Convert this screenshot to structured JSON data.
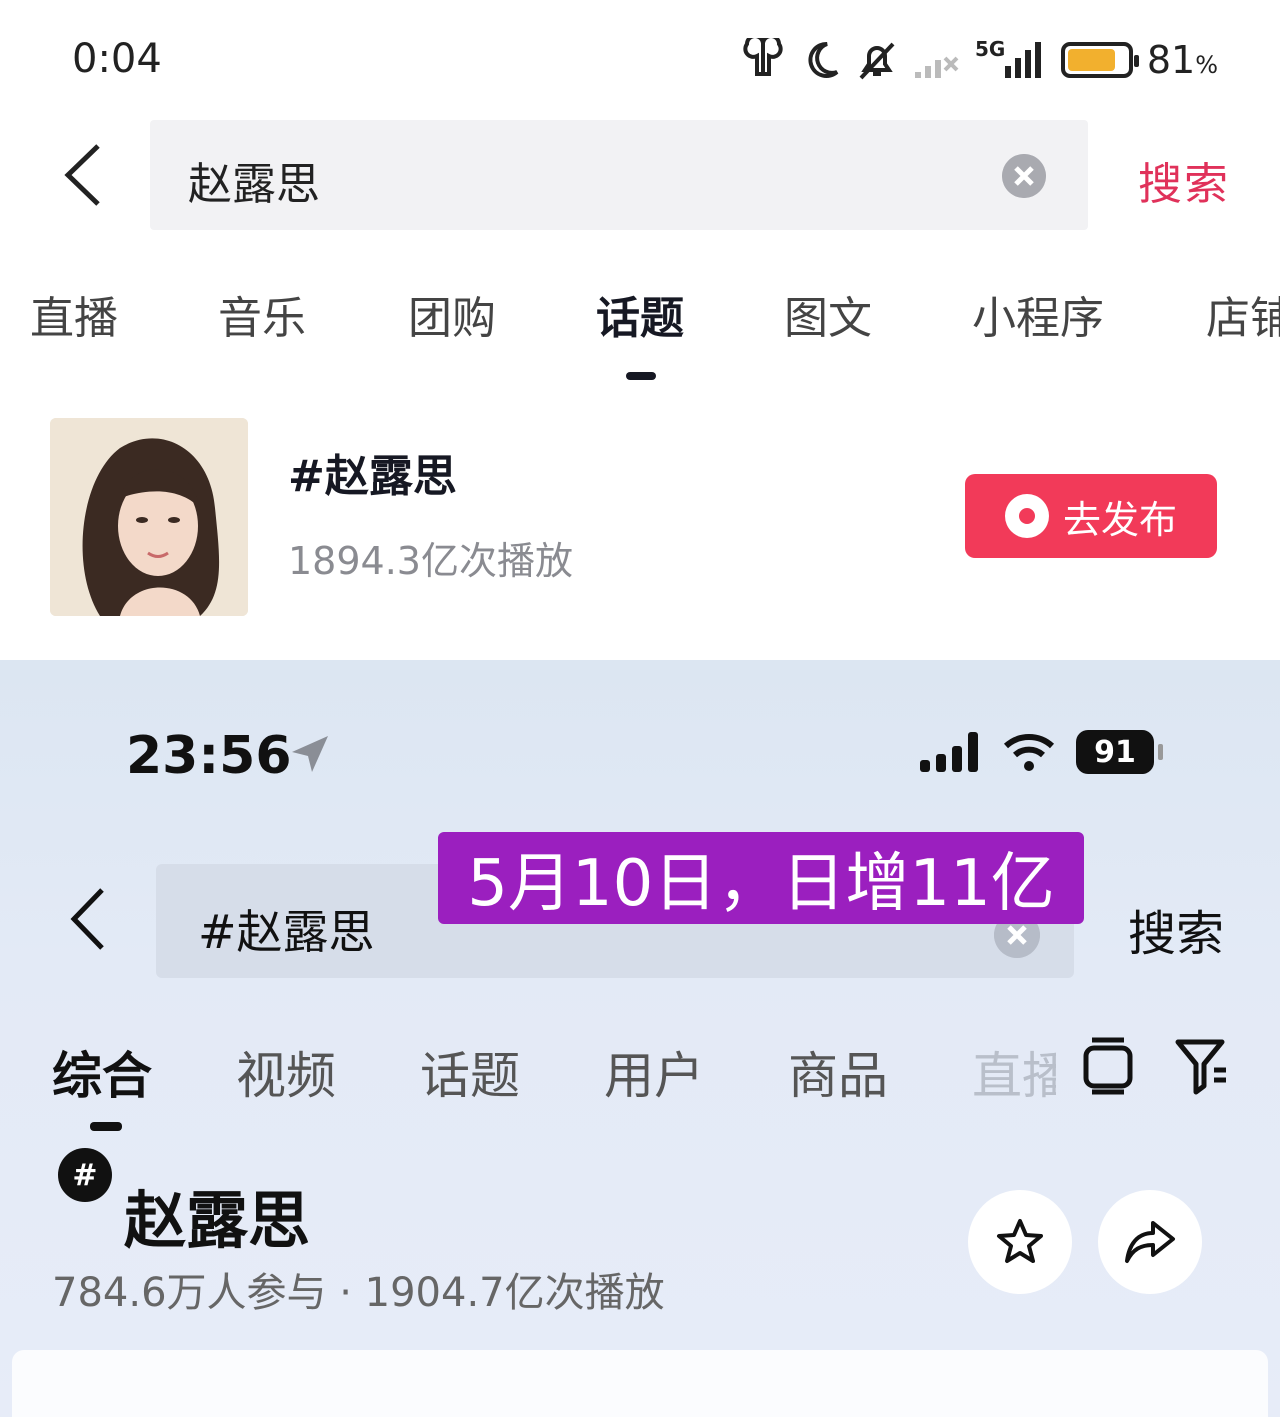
{
  "top": {
    "status_bar": {
      "time": "0:04",
      "network_label": "5G",
      "battery_percent": "81",
      "battery_unit": "%",
      "battery_level": 0.81
    },
    "search": {
      "query": "赵露思",
      "submit_label": "搜索"
    },
    "tabs": [
      {
        "label": "直播"
      },
      {
        "label": "音乐"
      },
      {
        "label": "团购"
      },
      {
        "label": "话题",
        "active": true
      },
      {
        "label": "图文"
      },
      {
        "label": "小程序"
      },
      {
        "label": "店铺"
      }
    ],
    "topic": {
      "title": "#赵露思",
      "views": "1894.3亿次播放",
      "publish_label": "去发布"
    }
  },
  "bottom": {
    "status_bar": {
      "time": "23:56",
      "battery": "91"
    },
    "search": {
      "query": "#赵露思",
      "submit_label": "搜索"
    },
    "overlay_text": "5月10日，日增11亿",
    "tabs": [
      {
        "label": "综合",
        "active": true
      },
      {
        "label": "视频"
      },
      {
        "label": "话题"
      },
      {
        "label": "用户"
      },
      {
        "label": "商品"
      },
      {
        "label": "直播"
      }
    ],
    "topic": {
      "badge": "#",
      "title": "赵露思",
      "meta": "784.6万人参与 · 1904.7亿次播放"
    }
  },
  "colors": {
    "accent_red": "#f23a59",
    "search_red": "#e0315a",
    "banner_purple": "#9b1fbf",
    "battery_yellow": "#f2b02e"
  }
}
